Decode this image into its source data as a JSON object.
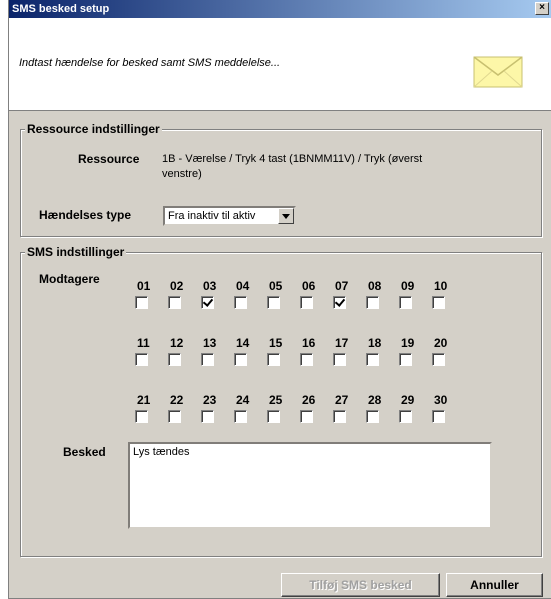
{
  "window": {
    "title": "SMS besked setup",
    "close_glyph": "×"
  },
  "header": {
    "instruction": "Indtast hændelse for besked samt SMS meddelelse...",
    "icon": "envelope-icon"
  },
  "resource_group": {
    "legend": "Ressource indstillinger",
    "resource_label": "Ressource",
    "resource_value_line1": "1B - Værelse  / Tryk 4 tast (1BNMM11V) / Tryk (øverst",
    "resource_value_line2": "venstre)",
    "event_type_label": "Hændelses type",
    "event_type_value": "Fra inaktiv til aktiv"
  },
  "sms_group": {
    "legend": "SMS indstillinger",
    "recipients_label": "Modtagere",
    "recipients": [
      {
        "num": "01",
        "checked": false
      },
      {
        "num": "02",
        "checked": false
      },
      {
        "num": "03",
        "checked": true
      },
      {
        "num": "04",
        "checked": false
      },
      {
        "num": "05",
        "checked": false
      },
      {
        "num": "06",
        "checked": false
      },
      {
        "num": "07",
        "checked": true
      },
      {
        "num": "08",
        "checked": false
      },
      {
        "num": "09",
        "checked": false
      },
      {
        "num": "10",
        "checked": false
      },
      {
        "num": "11",
        "checked": false
      },
      {
        "num": "12",
        "checked": false
      },
      {
        "num": "13",
        "checked": false
      },
      {
        "num": "14",
        "checked": false
      },
      {
        "num": "15",
        "checked": false
      },
      {
        "num": "16",
        "checked": false
      },
      {
        "num": "17",
        "checked": false
      },
      {
        "num": "18",
        "checked": false
      },
      {
        "num": "19",
        "checked": false
      },
      {
        "num": "20",
        "checked": false
      },
      {
        "num": "21",
        "checked": false
      },
      {
        "num": "22",
        "checked": false
      },
      {
        "num": "23",
        "checked": false
      },
      {
        "num": "24",
        "checked": false
      },
      {
        "num": "25",
        "checked": false
      },
      {
        "num": "26",
        "checked": false
      },
      {
        "num": "27",
        "checked": false
      },
      {
        "num": "28",
        "checked": false
      },
      {
        "num": "29",
        "checked": false
      },
      {
        "num": "30",
        "checked": false
      }
    ],
    "message_label": "Besked",
    "message_value": "Lys tændes"
  },
  "buttons": {
    "add_label": "Tilføj SMS besked",
    "cancel_label": "Annuller"
  },
  "colors": {
    "titlebar_start": "#0a246a",
    "titlebar_end": "#a6caf0",
    "dialog_bg": "#d4d0c8"
  }
}
